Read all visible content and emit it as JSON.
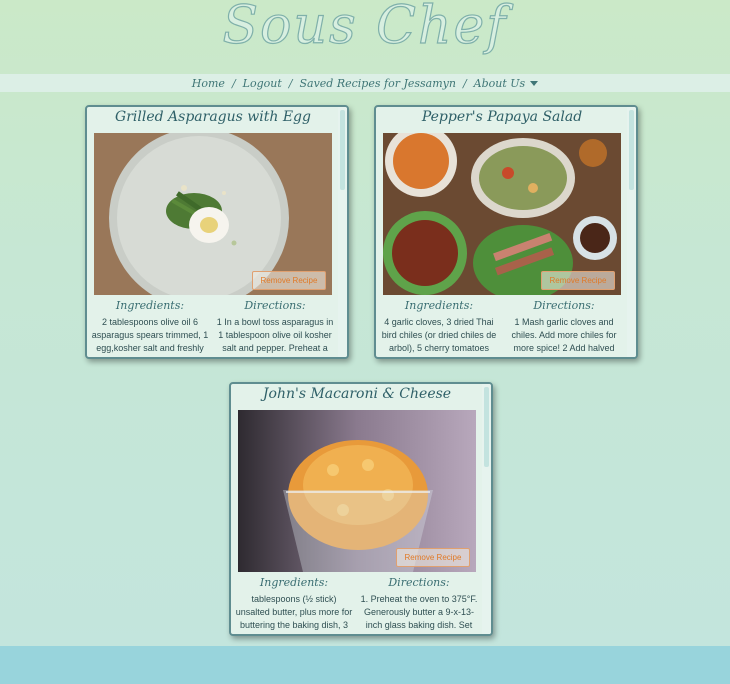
{
  "site": {
    "logo_text": "Sous Chef"
  },
  "nav": {
    "home": "Home",
    "logout": "Logout",
    "saved": "Saved Recipes for Jessamyn",
    "about": "About Us",
    "separator": "/"
  },
  "recipes": [
    {
      "title": "Grilled Asparagus with Egg",
      "remove_label": "Remove Recipe",
      "ingredients_label": "Ingredients:",
      "directions_label": "Directions:",
      "ingredients": "2 tablespoons olive oil 6 asparagus spears trimmed, 1 egg,kosher salt and freshly",
      "directions": "1 In a bowl toss asparagus in 1 tablespoon olive oil kosher salt and pepper. Preheat a"
    },
    {
      "title": "Pepper's Papaya Salad",
      "remove_label": "Remove Recipe",
      "ingredients_label": "Ingredients:",
      "directions_label": "Directions:",
      "ingredients": "4 garlic cloves, 3 dried Thai bird chiles (or dried chiles de arbol), 5 cherry tomatoes",
      "directions": "1 Mash garlic cloves and chiles. Add more chiles for more spice! 2 Add halved"
    },
    {
      "title": "John's Macaroni & Cheese",
      "remove_label": "Remove Recipe",
      "ingredients_label": "Ingredients:",
      "directions_label": "Directions:",
      "ingredients": "tablespoons (½ stick) unsalted butter, plus more for buttering the baking dish, 3",
      "directions": "1. Preheat the oven to 375°F. Generously butter a 9-x-13-inch glass baking dish. Set"
    }
  ]
}
